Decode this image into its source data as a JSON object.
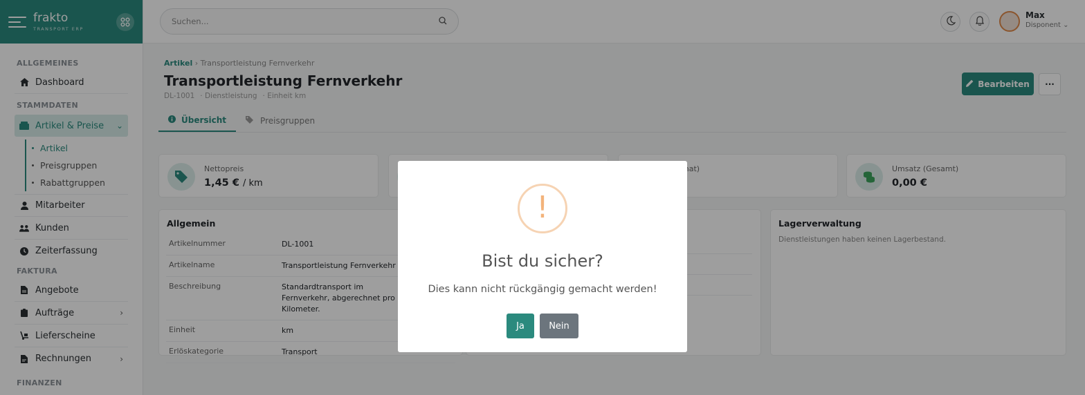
{
  "brand": {
    "name": "frakto",
    "tagline": "TRANSPORT ERP"
  },
  "sidebar": {
    "sections": {
      "general": "ALLGEMEINES",
      "master": "STAMMDATEN",
      "billing": "FAKTURA",
      "finance": "FINANZEN"
    },
    "items": {
      "dashboard": "Dashboard",
      "articles_prices": "Artikel & Preise",
      "employees": "Mitarbeiter",
      "customers": "Kunden",
      "time": "Zeiterfassung",
      "quotes": "Angebote",
      "orders": "Aufträge",
      "delivery": "Lieferscheine",
      "invoices": "Rechnungen"
    },
    "sub_items": [
      "Artikel",
      "Preisgruppen",
      "Rabattgruppen"
    ]
  },
  "header": {
    "search_placeholder": "Suchen...",
    "user_name": "Max",
    "user_role": "Disponent"
  },
  "page": {
    "breadcrumb_root": "Artikel",
    "breadcrumb_current": "Transportleistung Fernverkehr",
    "title": "Transportleistung Fernverkehr",
    "meta": [
      "DL-1001",
      "Dienstleistung",
      "Einheit km"
    ],
    "edit_label": "Bearbeiten",
    "more_label": "···",
    "tabs": [
      "Übersicht",
      "Preisgruppen"
    ]
  },
  "kpis": [
    {
      "label": "Nettopreis",
      "value": "1,45 €",
      "unit": "/ km"
    },
    {
      "label": "z (Monat)",
      "value": "€"
    },
    {
      "label": "Umsatz (Gesamt)",
      "value": "0,00 €"
    }
  ],
  "general": {
    "heading": "Allgemein",
    "rows": [
      {
        "k": "Artikelnummer",
        "v": "DL-1001"
      },
      {
        "k": "Artikelname",
        "v": "Transportleistung Fernverkehr"
      },
      {
        "k": "Beschreibung",
        "v": "Standardtransport im Fernverkehr, abgerechnet pro Kilometer."
      },
      {
        "k": "Einheit",
        "v": "km"
      },
      {
        "k": "Erlöskategorie",
        "v": "Transport"
      }
    ]
  },
  "stock": {
    "heading": "Lagerverwaltung",
    "note": "Dienstleistungen haben keinen Lagerbestand."
  },
  "dialog": {
    "icon": "!",
    "title": "Bist du sicher?",
    "text": "Dies kann nicht rückgängig gemacht werden!",
    "confirm": "Ja",
    "cancel": "Nein"
  },
  "colors": {
    "accent": "#2b8a7e",
    "warning": "#f3b37b",
    "cancel": "#6c757d"
  }
}
